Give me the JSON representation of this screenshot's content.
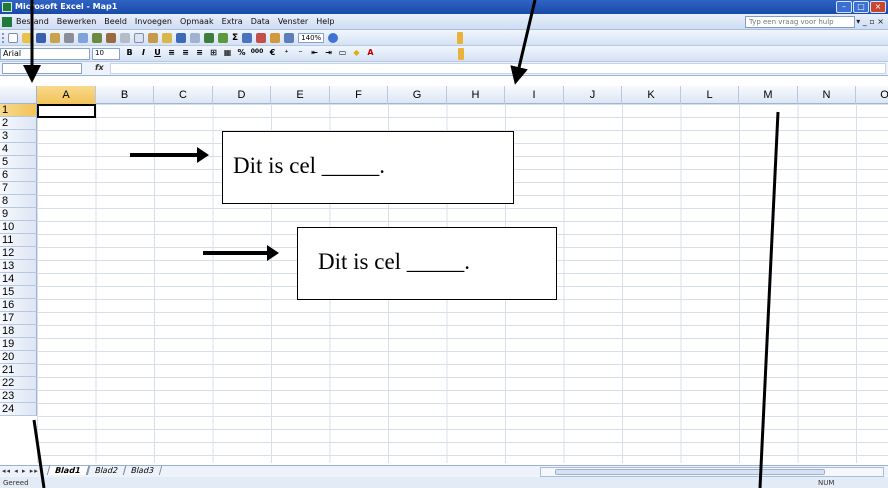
{
  "window": {
    "title": "Microsoft Excel - Map1",
    "buttons": [
      "minimize",
      "maximize",
      "close"
    ]
  },
  "menubar": {
    "items": [
      "Bestand",
      "Bewerken",
      "Beeld",
      "Invoegen",
      "Opmaak",
      "Extra",
      "Data",
      "Venster",
      "Help"
    ],
    "help_placeholder": "Typ een vraag voor hulp"
  },
  "toolbar": {
    "zoom": "140%",
    "sum_symbol": "Σ"
  },
  "format_toolbar": {
    "font": "Arial",
    "size": "10",
    "bold": "B",
    "italic": "I",
    "underline": "U",
    "percent": "%",
    "thousands": "000",
    "euro": "€"
  },
  "formula_bar": {
    "fx": "fx",
    "name_box": "",
    "formula": ""
  },
  "grid": {
    "columns": [
      "A",
      "B",
      "C",
      "D",
      "E",
      "F",
      "G",
      "H",
      "I",
      "J",
      "K",
      "L",
      "M",
      "N",
      "O"
    ],
    "rows": [
      "1",
      "2",
      "3",
      "4",
      "5",
      "6",
      "7",
      "8",
      "9",
      "10",
      "11",
      "12",
      "13",
      "14",
      "15",
      "16",
      "17",
      "18",
      "19",
      "20",
      "21",
      "22",
      "23",
      "24"
    ],
    "selected_column": "A",
    "selected_row": "1"
  },
  "sheets": {
    "tabs": [
      "Blad1",
      "Blad2",
      "Blad3"
    ],
    "active": "Blad1"
  },
  "status": {
    "left": "Gereed",
    "right": "NUM"
  },
  "worksheet_questions": [
    "Dit is cel _____.",
    "Dit is cel _____."
  ]
}
